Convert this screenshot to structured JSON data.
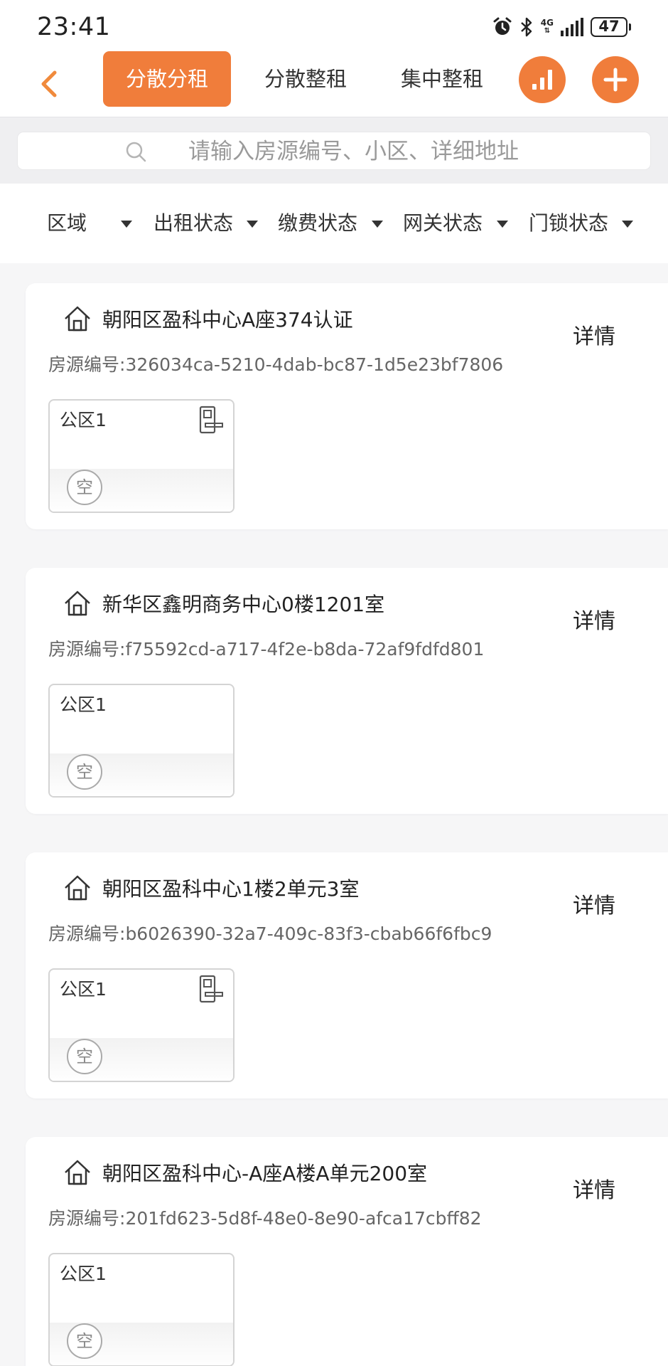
{
  "status_bar": {
    "time": "23:41",
    "network_type": "4G",
    "battery": "47",
    "icons": [
      "alarm-icon",
      "bluetooth-icon",
      "signal-icon",
      "battery-icon"
    ]
  },
  "header": {
    "back_icon": "chevron-left-icon",
    "tabs": [
      {
        "label": "分散分租",
        "active": true
      },
      {
        "label": "分散整租",
        "active": false
      },
      {
        "label": "集中整租",
        "active": false
      }
    ],
    "stats_icon": "bar-chart-icon",
    "add_icon": "plus-icon"
  },
  "search": {
    "placeholder": "请输入房源编号、小区、详细地址"
  },
  "filters": [
    {
      "label": "区域"
    },
    {
      "label": "出租状态"
    },
    {
      "label": "缴费状态"
    },
    {
      "label": "网关状态"
    },
    {
      "label": "门锁状态"
    }
  ],
  "code_prefix": "房源编号:",
  "details_label": "详情",
  "properties": [
    {
      "title": "朝阳区盈科中心A座374认证",
      "code": "326034ca-5210-4dab-bc87-1d5e23bf7806",
      "room": {
        "name": "公区1",
        "status": "空",
        "has_lock": true
      }
    },
    {
      "title": "新华区鑫明商务中心0楼1201室",
      "code": "f75592cd-a717-4f2e-b8da-72af9fdfd801",
      "room": {
        "name": "公区1",
        "status": "空",
        "has_lock": false
      }
    },
    {
      "title": "朝阳区盈科中心1楼2单元3室",
      "code": "b6026390-32a7-409c-83f3-cbab66f6fbc9",
      "room": {
        "name": "公区1",
        "status": "空",
        "has_lock": true
      }
    },
    {
      "title": "朝阳区盈科中心-A座A楼A单元200室",
      "code": "201fd623-5d8f-48e0-8e90-afca17cbff82",
      "room": {
        "name": "公区1",
        "status": "空",
        "has_lock": false
      }
    }
  ],
  "colors": {
    "accent": "#f07d3b",
    "background": "#f6f6f7",
    "text": "#222222",
    "muted": "#666666"
  }
}
